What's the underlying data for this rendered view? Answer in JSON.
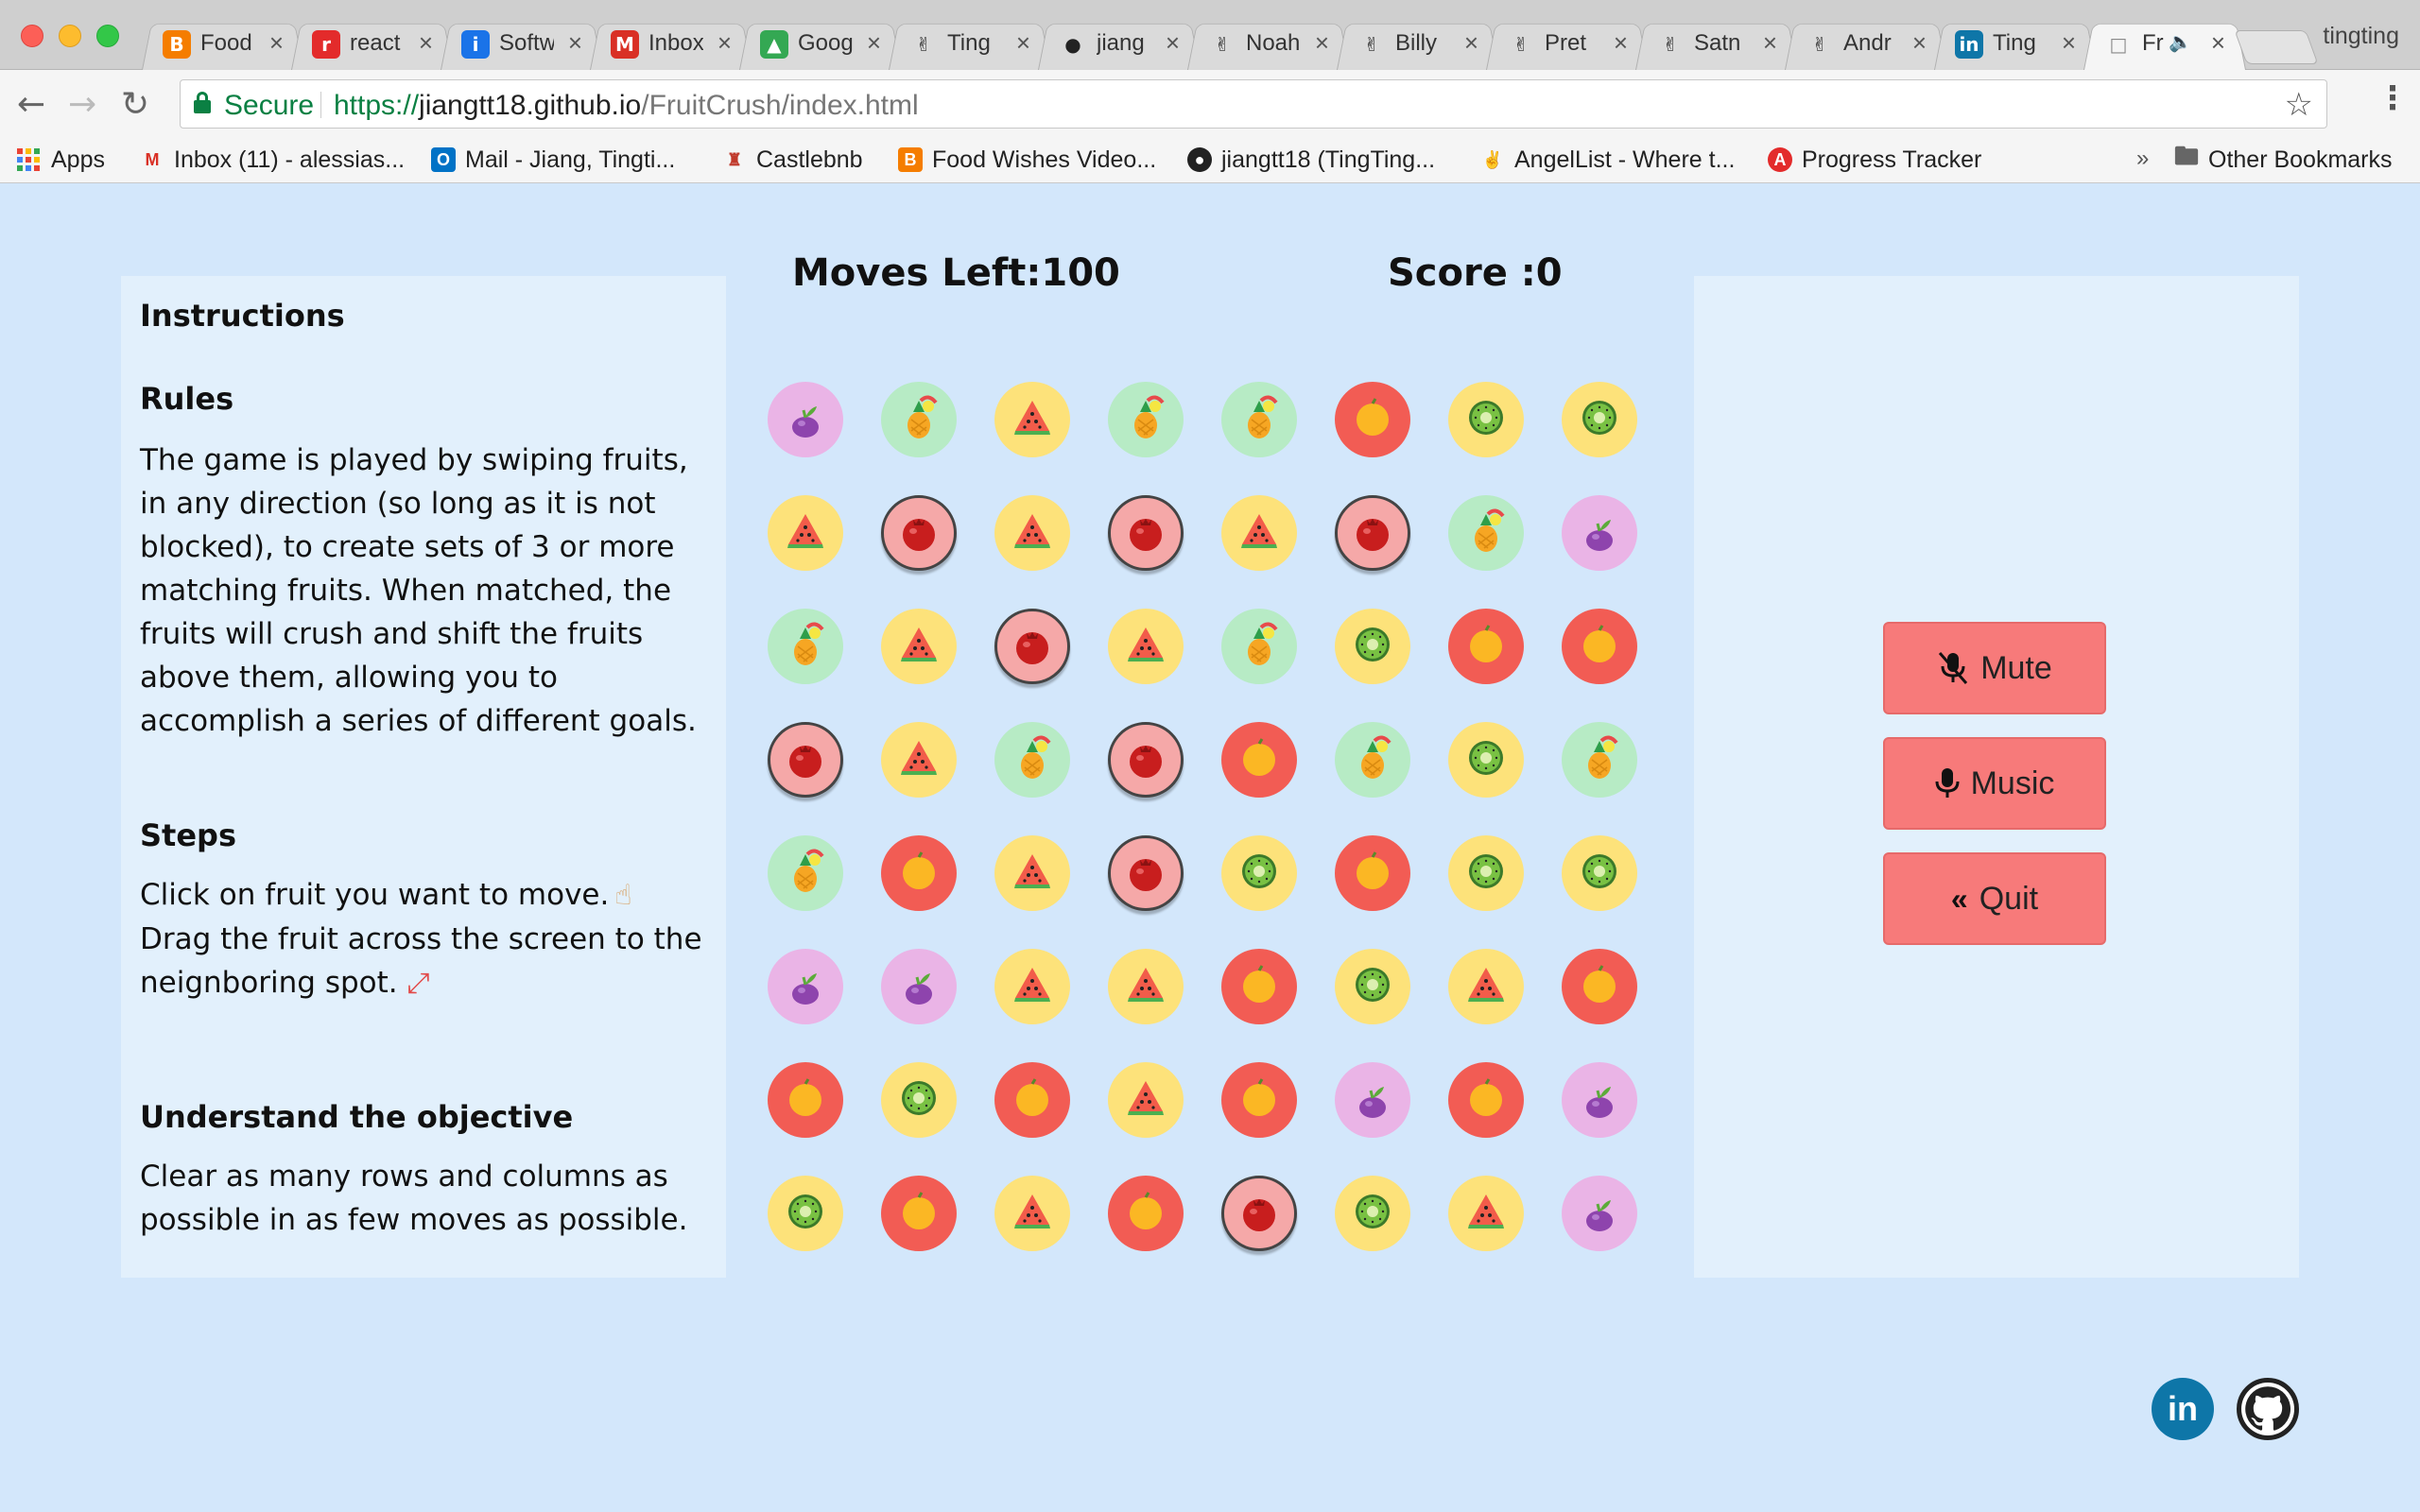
{
  "browser": {
    "tabs": [
      {
        "title": "Food",
        "favicon": "blogger-icon",
        "color": "#f57d00"
      },
      {
        "title": "react",
        "favicon": "react-icon",
        "color": "#e32b2b"
      },
      {
        "title": "Softw",
        "favicon": "info-icon",
        "color": "#1a73e8"
      },
      {
        "title": "Inbox",
        "favicon": "gmail-icon",
        "color": "#d93025"
      },
      {
        "title": "Goog",
        "favicon": "drive-icon",
        "color": "#34a853"
      },
      {
        "title": "Ting",
        "favicon": "angellist-icon",
        "color": "#222222"
      },
      {
        "title": "jiang",
        "favicon": "github-icon",
        "color": "#222222"
      },
      {
        "title": "Noah",
        "favicon": "angellist-icon",
        "color": "#222222"
      },
      {
        "title": "Billy",
        "favicon": "angellist-icon",
        "color": "#222222"
      },
      {
        "title": "Pret",
        "favicon": "angellist-icon",
        "color": "#222222"
      },
      {
        "title": "Satn",
        "favicon": "angellist-icon",
        "color": "#222222"
      },
      {
        "title": "Andr",
        "favicon": "angellist-icon",
        "color": "#222222"
      },
      {
        "title": "Ting",
        "favicon": "linkedin-icon",
        "color": "#0e76a8"
      },
      {
        "title": "Fr",
        "favicon": "page-icon",
        "color": "#888888",
        "active": true
      }
    ],
    "profile": "tingting",
    "secure_label": "Secure",
    "url": {
      "scheme": "https://",
      "host": "jiangtt18.github.io",
      "path": "/FruitCrush/index.html"
    },
    "bookmarks": [
      {
        "label": "Apps",
        "icon": "apps-icon"
      },
      {
        "label": "Inbox (11) - alessias...",
        "icon": "gmail-icon"
      },
      {
        "label": "Mail - Jiang, Tingti...",
        "icon": "outlook-icon"
      },
      {
        "label": "Castlebnb",
        "icon": "castle-icon"
      },
      {
        "label": "Food Wishes Video...",
        "icon": "blogger-icon"
      },
      {
        "label": "jiangtt18 (TingTing...",
        "icon": "github-icon"
      },
      {
        "label": "AngelList - Where t...",
        "icon": "angellist-icon"
      },
      {
        "label": "Progress Tracker",
        "icon": "app-academy-icon"
      }
    ],
    "other_bookmarks": "Other Bookmarks"
  },
  "instructions": {
    "heading": "Instructions",
    "rules_heading": "Rules",
    "rules_text": "The game is played by swiping fruits, in any direction (so long as it is not blocked), to create sets of 3 or more matching fruits. When matched, the fruits will crush and shift the fruits above them, allowing you to accomplish a series of different goals.",
    "steps_heading": "Steps",
    "step1": "Click on fruit you want to move.",
    "step2": "Drag the fruit across the screen to the neignboring spot.",
    "objective_heading": "Understand the objective",
    "objective_text": "Clear as many rows and columns as possible in as few moves as possible."
  },
  "game": {
    "moves_label": "Moves Left:100",
    "score_label": "Score :0",
    "board": [
      [
        "grape",
        "pineapple",
        "watermelon",
        "pineapple",
        "pineapple",
        "orange",
        "kiwi",
        "kiwi"
      ],
      [
        "watermelon",
        "pomegranate",
        "watermelon",
        "pomegranate",
        "watermelon",
        "pomegranate",
        "pineapple",
        "grape"
      ],
      [
        "pineapple",
        "watermelon",
        "pomegranate",
        "watermelon",
        "pineapple",
        "kiwi",
        "orange",
        "orange"
      ],
      [
        "pomegranate",
        "watermelon",
        "pineapple",
        "pomegranate",
        "orange",
        "pineapple",
        "kiwi",
        "pineapple"
      ],
      [
        "pineapple",
        "orange",
        "watermelon",
        "pomegranate",
        "kiwi",
        "orange",
        "kiwi",
        "kiwi"
      ],
      [
        "grape",
        "grape",
        "watermelon",
        "watermelon",
        "orange",
        "kiwi",
        "watermelon",
        "orange"
      ],
      [
        "orange",
        "kiwi",
        "orange",
        "watermelon",
        "orange",
        "grape",
        "orange",
        "grape"
      ],
      [
        "kiwi",
        "orange",
        "watermelon",
        "orange",
        "pomegranate",
        "kiwi",
        "watermelon",
        "grape"
      ]
    ]
  },
  "controls": {
    "mute_label": "Mute",
    "music_label": "Music",
    "quit_label": "Quit"
  },
  "footer": {
    "linkedin_label": "in"
  }
}
